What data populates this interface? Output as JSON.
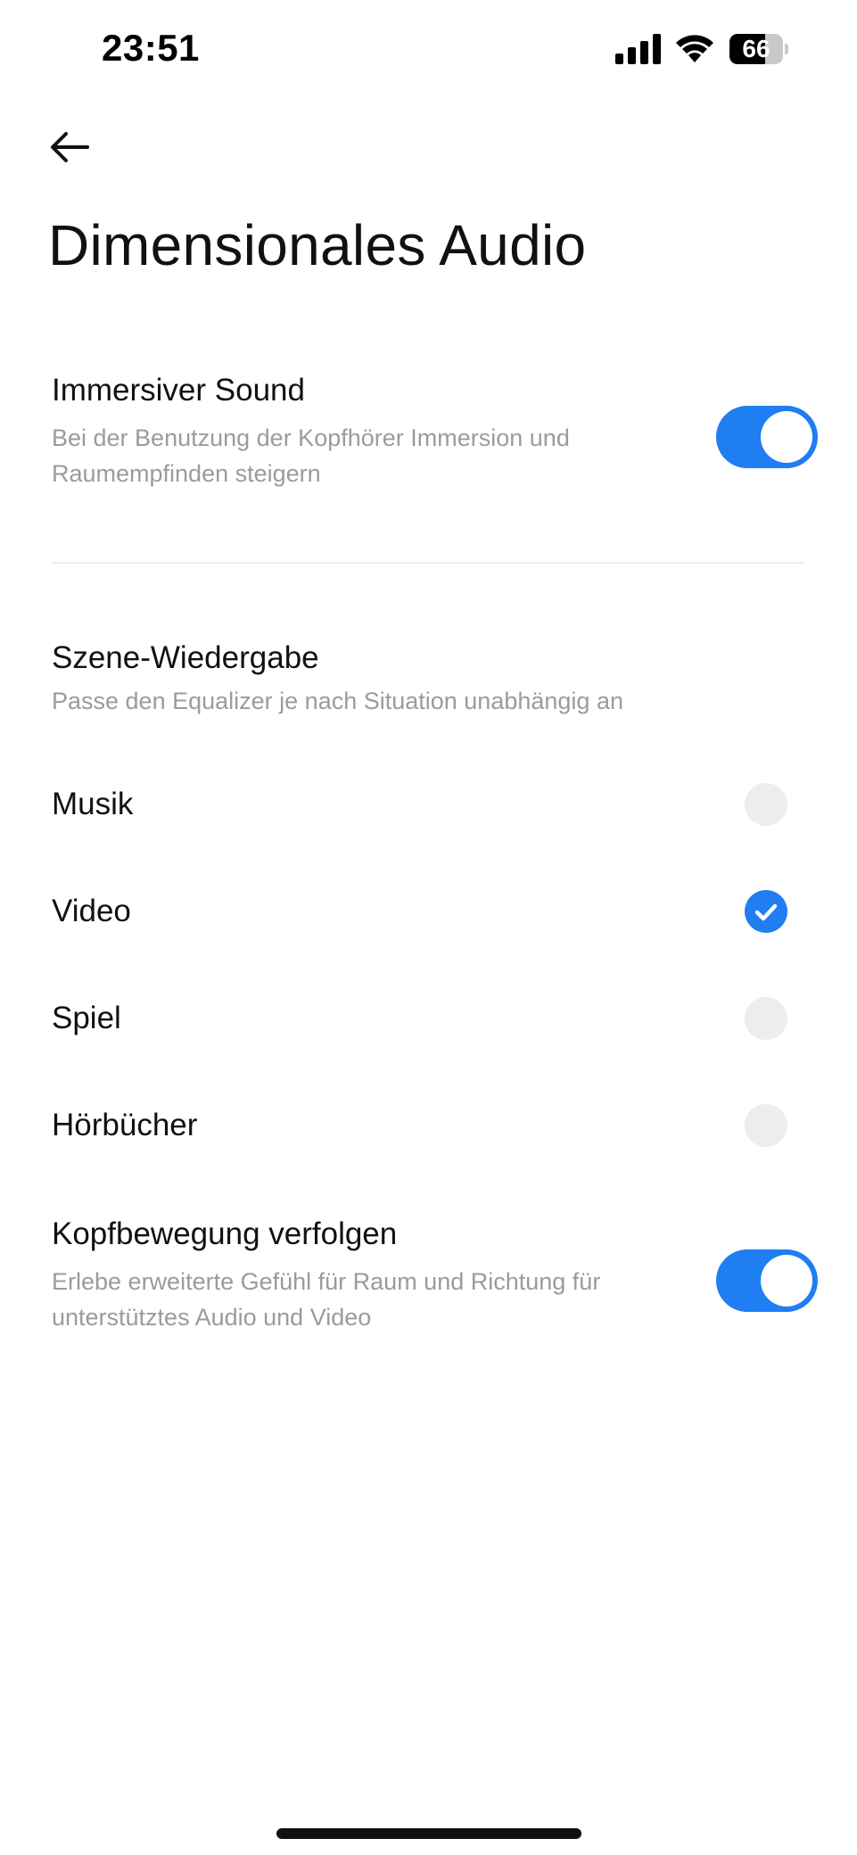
{
  "status_bar": {
    "time": "23:51",
    "battery_level": "66",
    "battery_fraction": 0.66
  },
  "header": {
    "back_icon": "arrow-left-icon",
    "title": "Dimensionales Audio"
  },
  "immersive_sound": {
    "title": "Immersiver Sound",
    "description": "Bei der Benutzung der Kopfhörer Immersion und Raumempfinden steigern",
    "enabled": true
  },
  "scene_playback": {
    "title": "Szene-Wiedergabe",
    "description": "Passe den Equalizer je nach Situation unabhängig an",
    "options": [
      {
        "label": "Musik",
        "selected": false
      },
      {
        "label": "Video",
        "selected": true
      },
      {
        "label": "Spiel",
        "selected": false
      },
      {
        "label": "Hörbücher",
        "selected": false
      }
    ]
  },
  "head_tracking": {
    "title": "Kopfbewegung verfolgen",
    "description": "Erlebe erweiterte Gefühl für Raum und Richtung für unterstütztes Audio und Video",
    "enabled": true
  },
  "colors": {
    "accent": "#1f7ef2",
    "text_primary": "#111111",
    "text_secondary": "#9b9b9b",
    "radio_off": "#ededed"
  }
}
